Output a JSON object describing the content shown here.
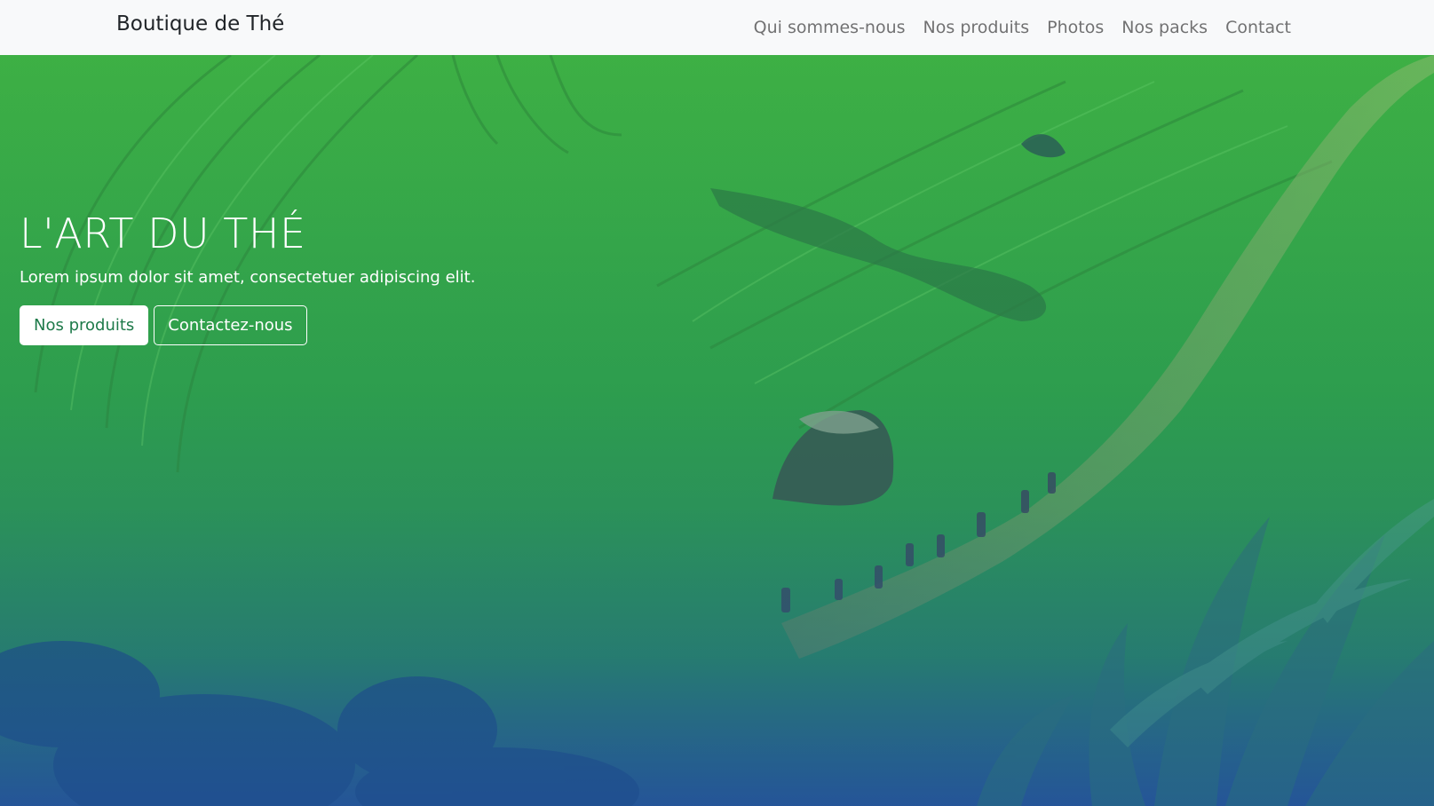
{
  "navbar": {
    "brand": "Boutique de Thé",
    "links": [
      "Qui sommes-nous",
      "Nos produits",
      "Photos",
      "Nos packs",
      "Contact"
    ]
  },
  "hero": {
    "title": "L'ART DU THÉ",
    "subtitle": "Lorem ipsum dolor sit amet, consectetuer adipiscing elit.",
    "primary_button": "Nos produits",
    "secondary_button": "Contactez-nous",
    "image": "rice-terrace-field",
    "overlay_color": "#1e5fa8"
  }
}
